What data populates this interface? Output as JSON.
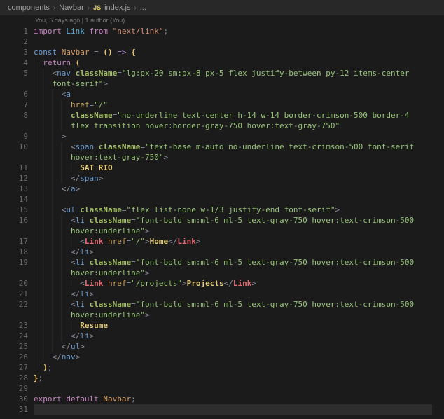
{
  "breadcrumb": {
    "path_items": [
      "components",
      "Navbar"
    ],
    "file_badge": "JS",
    "file_name": "index.js",
    "symbol": "...",
    "separator": "›"
  },
  "codelens": {
    "text": "You, 5 days ago | 1 author (You)"
  },
  "colors": {
    "bg": "#1b1b1b",
    "barbg": "#282828",
    "crumb": "#a0a0a0",
    "sep": "#707070",
    "jsicon": "#e8cf65",
    "lens": "#7d7d7d",
    "lnum": "#6b6b6b",
    "fg": "#c8c8c8",
    "hlbg": "#2d2d2d",
    "guide": "#323232",
    "kw": "#c586c0",
    "kwc": "#6f9fd6",
    "blu": "#5bacd8",
    "var": "#d19a66",
    "par": "#e9c46a",
    "arr": "#a88cc5",
    "pun": "#8b919e",
    "tag": "#6699cc",
    "comp": "#e06c75",
    "attr": "#a3bd68",
    "attr2": "#c9a35c",
    "str": "#98c379",
    "strm": "#ce9178",
    "jsx": "#e5cf7f"
  },
  "editor": {
    "rows": [
      {
        "n": "1",
        "ind": 0,
        "toks": [
          [
            "kw",
            "import"
          ],
          [
            "pl",
            " "
          ],
          [
            "blu",
            "Link"
          ],
          [
            "pl",
            " "
          ],
          [
            "kw",
            "from"
          ],
          [
            "pl",
            " "
          ],
          [
            "strm",
            "\"next/link\""
          ],
          [
            "pun",
            ";"
          ]
        ]
      },
      {
        "n": "2",
        "ind": 0,
        "toks": []
      },
      {
        "n": "3",
        "ind": 0,
        "toks": [
          [
            "kwc",
            "const"
          ],
          [
            "pl",
            " "
          ],
          [
            "var",
            "Navbar"
          ],
          [
            "pl",
            " "
          ],
          [
            "pun",
            "="
          ],
          [
            "pl",
            " "
          ],
          [
            "par",
            "()"
          ],
          [
            "pl",
            " "
          ],
          [
            "arr",
            "=>"
          ],
          [
            "pl",
            " "
          ],
          [
            "par",
            "{"
          ]
        ]
      },
      {
        "n": "4",
        "ind": 2,
        "toks": [
          [
            "pl",
            "  "
          ],
          [
            "kw",
            "return"
          ],
          [
            "pl",
            " "
          ],
          [
            "par",
            "("
          ]
        ]
      },
      {
        "n": "5",
        "ind": 4,
        "toks": [
          [
            "pl",
            "    "
          ],
          [
            "pun",
            "<"
          ],
          [
            "tag",
            "nav"
          ],
          [
            "pl",
            " "
          ],
          [
            "attr",
            "className"
          ],
          [
            "pun",
            "="
          ],
          [
            "str",
            "\"lg:px-20 sm:px-8 px-5 flex justify-between py-12 items-center"
          ]
        ]
      },
      {
        "n": "",
        "ind": 4,
        "toks": [
          [
            "pl",
            "    "
          ],
          [
            "str",
            "font-serif\""
          ],
          [
            "pun",
            ">"
          ]
        ]
      },
      {
        "n": "6",
        "ind": 6,
        "toks": [
          [
            "pl",
            "      "
          ],
          [
            "pun",
            "<"
          ],
          [
            "tag",
            "a"
          ]
        ]
      },
      {
        "n": "7",
        "ind": 8,
        "toks": [
          [
            "pl",
            "        "
          ],
          [
            "attr2",
            "href"
          ],
          [
            "pun",
            "="
          ],
          [
            "str",
            "\"/\""
          ]
        ]
      },
      {
        "n": "8",
        "ind": 8,
        "toks": [
          [
            "pl",
            "        "
          ],
          [
            "attr",
            "className"
          ],
          [
            "pun",
            "="
          ],
          [
            "str",
            "\"no-underline text-center h-14 w-14 border-crimson-500 border-4"
          ]
        ]
      },
      {
        "n": "",
        "ind": 8,
        "toks": [
          [
            "pl",
            "        "
          ],
          [
            "str",
            "flex transition hover:border-gray-750 hover:text-gray-750\""
          ]
        ]
      },
      {
        "n": "9",
        "ind": 6,
        "toks": [
          [
            "pl",
            "      "
          ],
          [
            "pun",
            ">"
          ]
        ]
      },
      {
        "n": "10",
        "ind": 8,
        "toks": [
          [
            "pl",
            "        "
          ],
          [
            "pun",
            "<"
          ],
          [
            "tag",
            "span"
          ],
          [
            "pl",
            " "
          ],
          [
            "attr",
            "className"
          ],
          [
            "pun",
            "="
          ],
          [
            "str",
            "\"text-base m-auto no-underline text-crimson-500 font-serif"
          ]
        ]
      },
      {
        "n": "",
        "ind": 8,
        "toks": [
          [
            "pl",
            "        "
          ],
          [
            "str",
            "hover:text-gray-750\""
          ],
          [
            "pun",
            ">"
          ]
        ]
      },
      {
        "n": "11",
        "ind": 10,
        "toks": [
          [
            "pl",
            "          "
          ],
          [
            "jsx",
            "SAT RIO"
          ]
        ]
      },
      {
        "n": "12",
        "ind": 8,
        "toks": [
          [
            "pl",
            "        "
          ],
          [
            "pun",
            "</"
          ],
          [
            "tag",
            "span"
          ],
          [
            "pun",
            ">"
          ]
        ]
      },
      {
        "n": "13",
        "ind": 6,
        "toks": [
          [
            "pl",
            "      "
          ],
          [
            "pun",
            "</"
          ],
          [
            "tag",
            "a"
          ],
          [
            "pun",
            ">"
          ]
        ]
      },
      {
        "n": "14",
        "ind": 6,
        "toks": []
      },
      {
        "n": "15",
        "ind": 6,
        "toks": [
          [
            "pl",
            "      "
          ],
          [
            "pun",
            "<"
          ],
          [
            "tag",
            "ul"
          ],
          [
            "pl",
            " "
          ],
          [
            "attr",
            "className"
          ],
          [
            "pun",
            "="
          ],
          [
            "str",
            "\"flex list-none w-1/3 justify-end font-serif\""
          ],
          [
            "pun",
            ">"
          ]
        ]
      },
      {
        "n": "16",
        "ind": 8,
        "toks": [
          [
            "pl",
            "        "
          ],
          [
            "pun",
            "<"
          ],
          [
            "tag",
            "li"
          ],
          [
            "pl",
            " "
          ],
          [
            "attr",
            "className"
          ],
          [
            "pun",
            "="
          ],
          [
            "str",
            "\"font-bold sm:ml-6 ml-5 text-gray-750 hover:text-crimson-500"
          ]
        ]
      },
      {
        "n": "",
        "ind": 8,
        "toks": [
          [
            "pl",
            "        "
          ],
          [
            "str",
            "hover:underline\""
          ],
          [
            "pun",
            ">"
          ]
        ]
      },
      {
        "n": "17",
        "ind": 10,
        "toks": [
          [
            "pl",
            "          "
          ],
          [
            "pun",
            "<"
          ],
          [
            "comp",
            "Link"
          ],
          [
            "pl",
            " "
          ],
          [
            "attr2",
            "href"
          ],
          [
            "pun",
            "="
          ],
          [
            "str",
            "\"/\""
          ],
          [
            "pun",
            ">"
          ],
          [
            "jsx",
            "Home"
          ],
          [
            "pun",
            "</"
          ],
          [
            "comp",
            "Link"
          ],
          [
            "pun",
            ">"
          ]
        ]
      },
      {
        "n": "18",
        "ind": 8,
        "toks": [
          [
            "pl",
            "        "
          ],
          [
            "pun",
            "</"
          ],
          [
            "tag",
            "li"
          ],
          [
            "pun",
            ">"
          ]
        ]
      },
      {
        "n": "19",
        "ind": 8,
        "toks": [
          [
            "pl",
            "        "
          ],
          [
            "pun",
            "<"
          ],
          [
            "tag",
            "li"
          ],
          [
            "pl",
            " "
          ],
          [
            "attr",
            "className"
          ],
          [
            "pun",
            "="
          ],
          [
            "str",
            "\"font-bold sm:ml-6 ml-5 text-gray-750 hover:text-crimson-500"
          ]
        ]
      },
      {
        "n": "",
        "ind": 8,
        "toks": [
          [
            "pl",
            "        "
          ],
          [
            "str",
            "hover:underline\""
          ],
          [
            "pun",
            ">"
          ]
        ]
      },
      {
        "n": "20",
        "ind": 10,
        "toks": [
          [
            "pl",
            "          "
          ],
          [
            "pun",
            "<"
          ],
          [
            "comp",
            "Link"
          ],
          [
            "pl",
            " "
          ],
          [
            "attr2",
            "href"
          ],
          [
            "pun",
            "="
          ],
          [
            "str",
            "\"/projects\""
          ],
          [
            "pun",
            ">"
          ],
          [
            "jsx",
            "Projects"
          ],
          [
            "pun",
            "</"
          ],
          [
            "comp",
            "Link"
          ],
          [
            "pun",
            ">"
          ]
        ]
      },
      {
        "n": "21",
        "ind": 8,
        "toks": [
          [
            "pl",
            "        "
          ],
          [
            "pun",
            "</"
          ],
          [
            "tag",
            "li"
          ],
          [
            "pun",
            ">"
          ]
        ]
      },
      {
        "n": "22",
        "ind": 8,
        "toks": [
          [
            "pl",
            "        "
          ],
          [
            "pun",
            "<"
          ],
          [
            "tag",
            "li"
          ],
          [
            "pl",
            " "
          ],
          [
            "attr",
            "className"
          ],
          [
            "pun",
            "="
          ],
          [
            "str",
            "\"font-bold sm:ml-6 ml-5 text-gray-750 hover:text-crimson-500"
          ]
        ]
      },
      {
        "n": "",
        "ind": 8,
        "toks": [
          [
            "pl",
            "        "
          ],
          [
            "str",
            "hover:underline\""
          ],
          [
            "pun",
            ">"
          ]
        ]
      },
      {
        "n": "23",
        "ind": 10,
        "toks": [
          [
            "pl",
            "          "
          ],
          [
            "jsx",
            "Resume"
          ]
        ]
      },
      {
        "n": "24",
        "ind": 8,
        "toks": [
          [
            "pl",
            "        "
          ],
          [
            "pun",
            "</"
          ],
          [
            "tag",
            "li"
          ],
          [
            "pun",
            ">"
          ]
        ]
      },
      {
        "n": "25",
        "ind": 6,
        "toks": [
          [
            "pl",
            "      "
          ],
          [
            "pun",
            "</"
          ],
          [
            "tag",
            "ul"
          ],
          [
            "pun",
            ">"
          ]
        ]
      },
      {
        "n": "26",
        "ind": 4,
        "toks": [
          [
            "pl",
            "    "
          ],
          [
            "pun",
            "</"
          ],
          [
            "tag",
            "nav"
          ],
          [
            "pun",
            ">"
          ]
        ]
      },
      {
        "n": "27",
        "ind": 2,
        "toks": [
          [
            "pl",
            "  "
          ],
          [
            "par",
            ")"
          ],
          [
            "pun",
            ";"
          ]
        ]
      },
      {
        "n": "28",
        "ind": 0,
        "toks": [
          [
            "par",
            "}"
          ],
          [
            "pun",
            ";"
          ]
        ]
      },
      {
        "n": "29",
        "ind": 0,
        "toks": []
      },
      {
        "n": "30",
        "ind": 0,
        "toks": [
          [
            "kw",
            "export"
          ],
          [
            "pl",
            " "
          ],
          [
            "kw",
            "default"
          ],
          [
            "pl",
            " "
          ],
          [
            "var",
            "Navbar"
          ],
          [
            "pun",
            ";"
          ]
        ]
      },
      {
        "n": "31",
        "ind": 0,
        "hl": true,
        "toks": []
      }
    ]
  }
}
